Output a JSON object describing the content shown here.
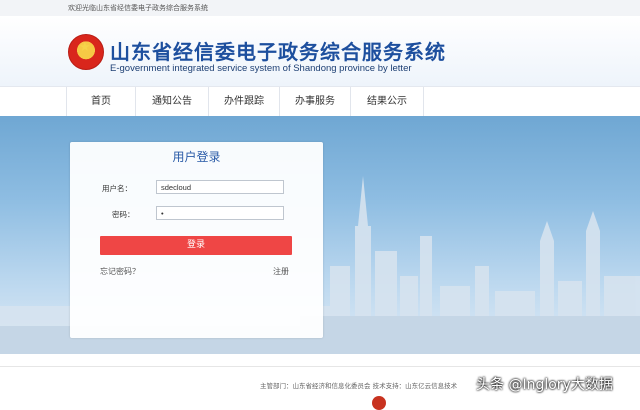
{
  "topbar": {
    "welcome": "欢迎光临山东省经信委电子政务综合服务系统"
  },
  "header": {
    "title_cn": "山东省经信委电子政务综合服务系统",
    "title_en": "E-government integrated service system of Shandong province by letter"
  },
  "nav": {
    "items": [
      {
        "label": "首页"
      },
      {
        "label": "通知公告"
      },
      {
        "label": "办件跟踪"
      },
      {
        "label": "办事服务"
      },
      {
        "label": "结果公示"
      }
    ]
  },
  "login": {
    "title": "用户登录",
    "username_label": "用户名：",
    "username_value": "sdecloud",
    "password_label": "密码：",
    "password_value": "•",
    "submit_label": "登录",
    "forgot_label": "忘记密码？",
    "register_label": "注册"
  },
  "footer": {
    "text": "主管部门：山东省经济和信息化委员会 技术支持：山东亿云信息技术"
  },
  "watermark": {
    "text": "头条 @Inglory大数据"
  },
  "colors": {
    "primary_blue": "#1d4f9e",
    "login_button": "#ef4645",
    "banner_sky": "#8ebde2"
  }
}
